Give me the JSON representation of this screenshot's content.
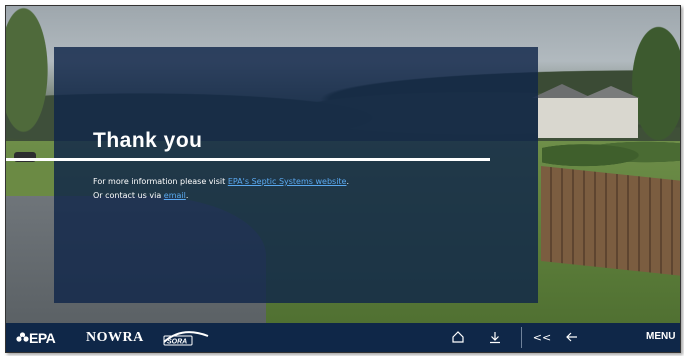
{
  "panel": {
    "title": "Thank you",
    "line1_prefix": "For more information please visit ",
    "line1_link": "EPA's Septic Systems website",
    "line1_suffix": ".",
    "line2_prefix": "Or contact us via ",
    "line2_link": "email",
    "line2_suffix": "."
  },
  "footer": {
    "logos": {
      "epa": "EPA",
      "nowra": "NOWRA",
      "sora": "SORA"
    },
    "nav": {
      "home_icon": "home-icon",
      "download_icon": "download-icon",
      "prev_label": "<<",
      "back_icon": "back-arrow-icon",
      "menu_label": "MENU"
    }
  },
  "colors": {
    "panel_bg": "#102649",
    "navbar_bg": "#0f2748",
    "link": "#5aa9f0",
    "text": "#ffffff"
  }
}
